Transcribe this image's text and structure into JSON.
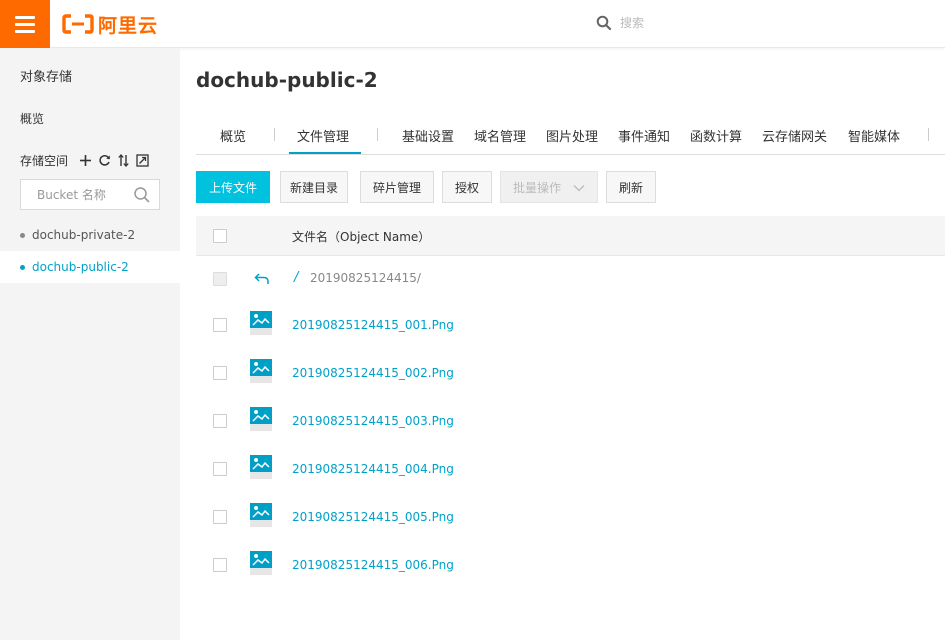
{
  "brand": {
    "name": "阿里云",
    "accent": "#ff6a00",
    "link_color": "#00a2ca",
    "primary_btn": "#00c1de"
  },
  "header": {
    "search_placeholder": "搜索"
  },
  "sidebar": {
    "title": "对象存储",
    "overview": "概览",
    "space_label": "存储空间",
    "tools": [
      "plus-icon",
      "refresh-icon",
      "sort-icon",
      "expand-icon"
    ],
    "bucket_search_placeholder": "Bucket 名称",
    "buckets": [
      {
        "name": "dochub-private-2",
        "active": false
      },
      {
        "name": "dochub-public-2",
        "active": true
      }
    ]
  },
  "main": {
    "title": "dochub-public-2",
    "tabs": [
      "概览",
      "文件管理",
      "基础设置",
      "域名管理",
      "图片处理",
      "事件通知",
      "函数计算",
      "云存储网关",
      "智能媒体"
    ],
    "active_tab": "文件管理",
    "toolbar": {
      "upload": "上传文件",
      "new_dir": "新建目录",
      "fragments": "碎片管理",
      "authorize": "授权",
      "batch": "批量操作",
      "refresh": "刷新"
    },
    "table": {
      "header": "文件名（Object Name）",
      "parent_path_slash": "/",
      "parent_path": "20190825124415/",
      "files": [
        "20190825124415_001.Png",
        "20190825124415_002.Png",
        "20190825124415_003.Png",
        "20190825124415_004.Png",
        "20190825124415_005.Png",
        "20190825124415_006.Png"
      ]
    }
  }
}
